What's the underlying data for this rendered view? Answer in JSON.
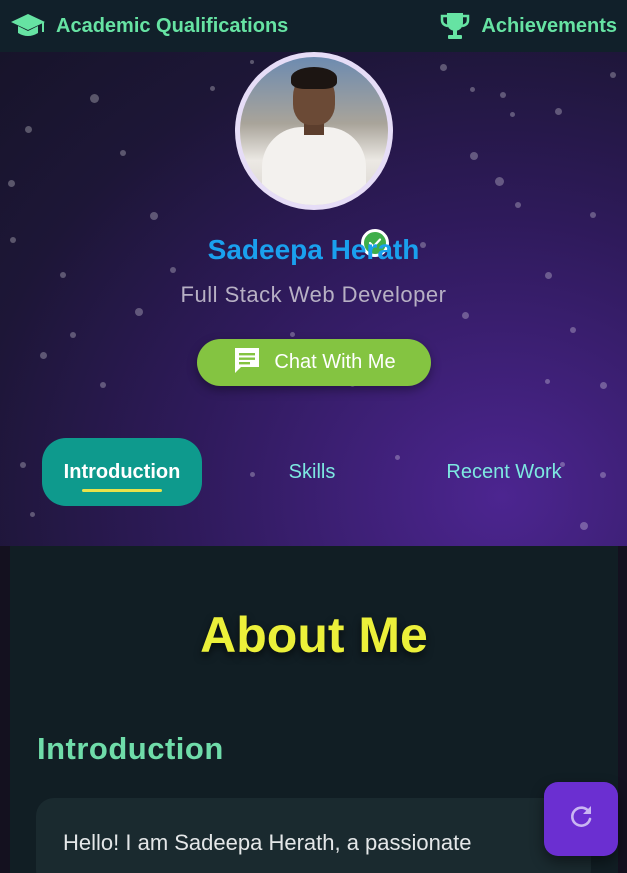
{
  "nav": {
    "left": {
      "label": "Academic Qualifications",
      "icon": "graduation-cap-icon"
    },
    "right": {
      "label": "Achievements",
      "icon": "trophy-icon"
    }
  },
  "profile": {
    "name": "Sadeepa Herath",
    "role": "Full Stack Web Developer",
    "verified_icon": "check-badge-icon",
    "chat_button": "Chat With Me",
    "chat_icon": "message-icon"
  },
  "tabs": [
    {
      "label": "Introduction",
      "active": true
    },
    {
      "label": "Skills",
      "active": false
    },
    {
      "label": "Recent Work",
      "active": false
    }
  ],
  "content": {
    "heading": "About Me",
    "section_title": "Introduction",
    "intro_text": "Hello! I am Sadeepa Herath, a passionate"
  },
  "fab": {
    "icon": "refresh-icon"
  },
  "colors": {
    "accent_green": "#66e3a3",
    "name_blue": "#1aa0ee",
    "chat_green": "#84c441",
    "tab_teal": "#0e9a8d",
    "heading_yellow": "#ecf03a",
    "fab_purple": "#6b2fd1"
  }
}
